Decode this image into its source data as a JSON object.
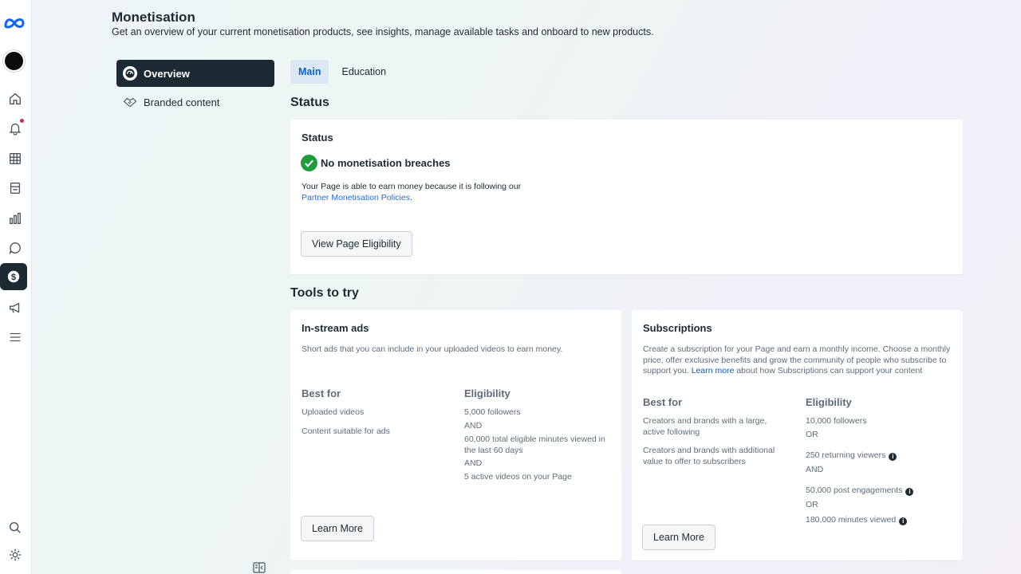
{
  "header": {
    "title": "Monetisation",
    "subtitle": "Get an overview of your current monetisation products, see insights, manage available tasks and onboard to new products."
  },
  "rail": {
    "icons": [
      "meta-logo",
      "avatar",
      "home-icon",
      "bell-icon",
      "table-icon",
      "content-icon",
      "insights-icon",
      "chat-icon",
      "dollar-icon",
      "megaphone-icon",
      "menu-icon",
      "search-icon",
      "gear-icon"
    ],
    "active": "dollar-icon"
  },
  "side_nav": {
    "items": [
      {
        "label": "Overview",
        "icon": "overview-icon",
        "active": true
      },
      {
        "label": "Branded content",
        "icon": "handshake-icon",
        "active": false
      }
    ]
  },
  "tabs": [
    {
      "label": "Main",
      "active": true
    },
    {
      "label": "Education",
      "active": false
    }
  ],
  "status_section": {
    "title": "Status",
    "card_title": "Status",
    "headline": "No monetisation breaches",
    "desc": "Your Page is able to earn money because it is following our",
    "policy_link": "Partner Monetisation Policies",
    "period": ".",
    "button": "View Page Eligibility"
  },
  "tools_section": {
    "title": "Tools to try",
    "instream": {
      "title": "In-stream ads",
      "desc": "Short ads that you can include in your uploaded videos to earn money.",
      "best_for_label": "Best for",
      "best_for": [
        "Uploaded videos",
        "Content suitable for ads"
      ],
      "eligibility_label": "Eligibility",
      "eligibility": [
        "5,000 followers",
        "AND",
        "60,000 total eligible minutes viewed in the last 60 days",
        "AND",
        "5 active videos on your Page"
      ],
      "button": "Learn More"
    },
    "subscriptions": {
      "title": "Subscriptions",
      "desc_before": "Create a subscription for your Page and earn a monthly income. Choose a monthly price, offer exclusive benefits and grow the community of people who subscribe to support you.",
      "desc_link": "Learn more",
      "desc_after": "about how Subscriptions can support your content",
      "best_for_label": "Best for",
      "best_for": [
        "Creators and brands with a large, active following",
        "Creators and brands with additional value to offer to subscribers"
      ],
      "eligibility_label": "Eligibility",
      "eligibility": [
        "10,000 followers",
        "OR",
        "250 returning viewers",
        "AND",
        "50,000 post engagements",
        "OR",
        "180,000 minutes viewed"
      ],
      "button": "Learn More"
    }
  },
  "colors": {
    "accent": "#0a66c2",
    "success": "#1f9d3a",
    "dark": "#1c2b33",
    "notification": "#e0245e"
  }
}
